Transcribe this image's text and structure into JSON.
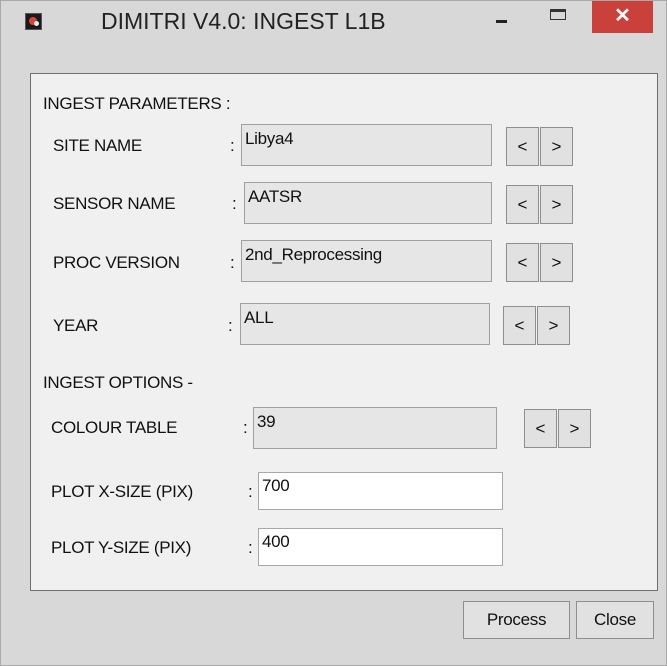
{
  "window": {
    "title": "DIMITRI V4.0: INGEST L1B",
    "close_glyph": "✕",
    "icons": {
      "app": "app-icon",
      "minimize": "minimize-icon",
      "maximize": "maximize-icon",
      "close": "close-icon"
    },
    "colors": {
      "close_button": "#c9413a",
      "panel": "#f0f0f0",
      "frame": "#d8d8d8"
    }
  },
  "ingest_parameters": {
    "heading": "INGEST PARAMETERS :",
    "site_name": {
      "label": "SITE NAME",
      "colon": ":",
      "value": "Libya4"
    },
    "sensor_name": {
      "label": "SENSOR NAME",
      "colon": ":",
      "value": "AATSR"
    },
    "proc_version": {
      "label": "PROC VERSION",
      "colon": ":",
      "value": "2nd_Reprocessing"
    },
    "year": {
      "label": "YEAR",
      "colon": ":",
      "value": "ALL"
    }
  },
  "ingest_options": {
    "heading": "INGEST OPTIONS -",
    "colour_table": {
      "label": "COLOUR TABLE",
      "colon": ":",
      "value": "39"
    },
    "plot_x_size": {
      "label": "PLOT X-SIZE (PIX)",
      "colon": ":",
      "value": "700"
    },
    "plot_y_size": {
      "label": "PLOT Y-SIZE (PIX)",
      "colon": ":",
      "value": "400"
    }
  },
  "arrows": {
    "prev": "<",
    "next": ">"
  },
  "actions": {
    "process": "Process",
    "close": "Close"
  }
}
